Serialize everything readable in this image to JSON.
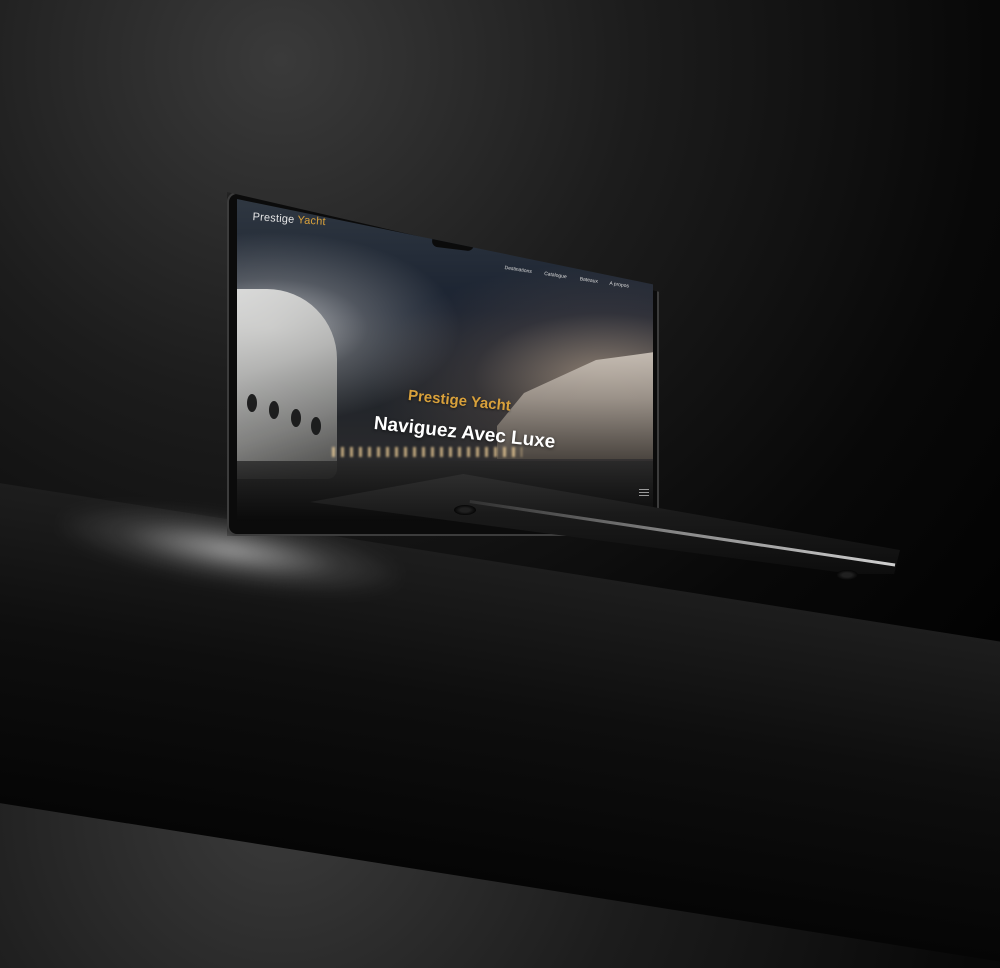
{
  "website": {
    "logo_primary": "Prestige",
    "logo_accent": "Yacht",
    "nav_items": [
      "Destinations",
      "Catalogue",
      "Bateaux",
      "A propos"
    ],
    "hero_subtitle": "Prestige Yacht",
    "hero_title": "Naviguez Avec Luxe"
  },
  "colors": {
    "accent": "#d9a13b",
    "text_light": "#ffffff",
    "background": "#000000"
  },
  "icons": {
    "menu": "hamburger-icon"
  }
}
